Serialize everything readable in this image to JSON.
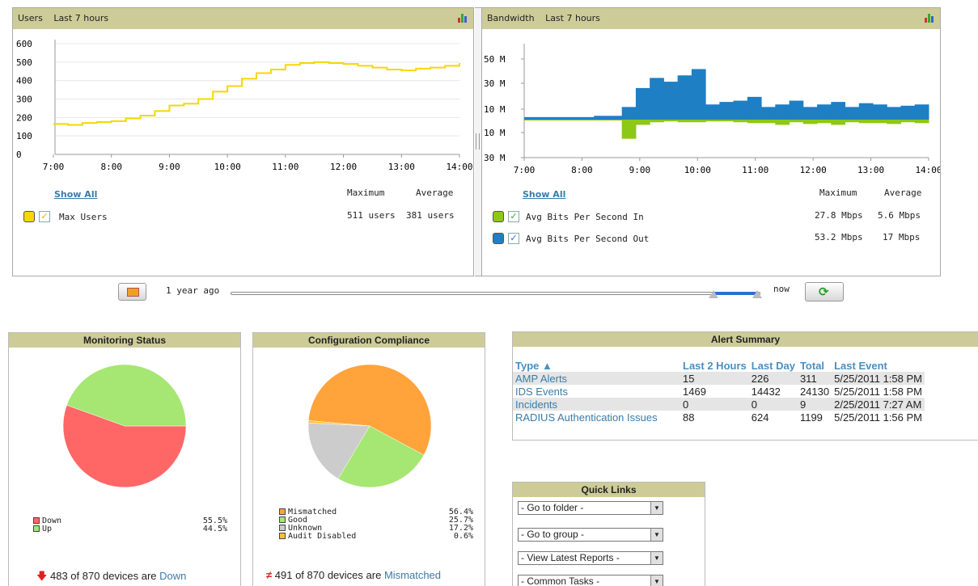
{
  "users_panel": {
    "title": "Users",
    "range": "Last 7 hours",
    "y_ticks": [
      "600",
      "500",
      "400",
      "300",
      "200",
      "100",
      "0"
    ],
    "x_ticks": [
      "7:00",
      "8:00",
      "9:00",
      "10:00",
      "11:00",
      "12:00",
      "13:00",
      "14:00"
    ],
    "show_all": "Show All",
    "col_max": "Maximum",
    "col_avg": "Average",
    "series": [
      {
        "name": "Max Users",
        "color": "#f5d800",
        "max": "511 users",
        "avg": "381 users"
      }
    ]
  },
  "bandwidth_panel": {
    "title": "Bandwidth",
    "range": "Last 7 hours",
    "y_ticks": [
      "50 M",
      "30 M",
      "10 M",
      "10 M",
      "30 M"
    ],
    "x_ticks": [
      "7:00",
      "8:00",
      "9:00",
      "10:00",
      "11:00",
      "12:00",
      "13:00",
      "14:00"
    ],
    "show_all": "Show All",
    "col_max": "Maximum",
    "col_avg": "Average",
    "series": [
      {
        "name": "Avg Bits Per Second In",
        "color": "#8cc814",
        "max": "27.8 Mbps",
        "avg": "5.6 Mbps"
      },
      {
        "name": "Avg Bits Per Second Out",
        "color": "#1e7fc4",
        "max": "53.2 Mbps",
        "avg": "17 Mbps"
      }
    ]
  },
  "timeline": {
    "start_label": "1 year ago",
    "end_label": "now",
    "selected_start_fraction": 0.93,
    "selected_end_fraction": 1.0
  },
  "monitoring": {
    "title": "Monitoring Status",
    "legend": [
      {
        "label": "Down",
        "pct": "55.5%",
        "value": 55.5,
        "color": "#ff6666"
      },
      {
        "label": "Up",
        "pct": "44.5%",
        "value": 44.5,
        "color": "#a6e672"
      }
    ],
    "status_prefix": "483 of 870 devices are",
    "status_link": "Down"
  },
  "compliance": {
    "title": "Configuration Compliance",
    "legend": [
      {
        "label": "Mismatched",
        "pct": "56.4%",
        "value": 56.4,
        "color": "#ffa33a"
      },
      {
        "label": "Good",
        "pct": "25.7%",
        "value": 25.7,
        "color": "#a6e672"
      },
      {
        "label": "Unknown",
        "pct": "17.2%",
        "value": 17.2,
        "color": "#cccccc"
      },
      {
        "label": "Audit Disabled",
        "pct": "0.6%",
        "value": 0.6,
        "color": "#ffc040"
      }
    ],
    "status_prefix": "491 of 870 devices are",
    "status_link": "Mismatched"
  },
  "alert_summary": {
    "title": "Alert Summary",
    "headers": [
      "Type ▲",
      "Last 2 Hours",
      "Last Day",
      "Total",
      "Last Event"
    ],
    "rows": [
      [
        "AMP Alerts",
        "15",
        "226",
        "311",
        "5/25/2011 1:58 PM"
      ],
      [
        "IDS Events",
        "1469",
        "14432",
        "24130",
        "5/25/2011 1:58 PM"
      ],
      [
        "Incidents",
        "0",
        "0",
        "9",
        "2/25/2011 7:27 AM"
      ],
      [
        "RADIUS Authentication Issues",
        "88",
        "624",
        "1199",
        "5/25/2011 1:56 PM"
      ]
    ]
  },
  "quick_links": {
    "title": "Quick Links",
    "selects": [
      "- Go to folder -",
      "- Go to group -",
      "- View Latest Reports -",
      "- Common Tasks -"
    ]
  },
  "chart_data": [
    {
      "type": "line",
      "title": "Users",
      "subtitle": "Last 7 hours",
      "x": [
        "7:00",
        "7:15",
        "7:30",
        "7:45",
        "8:00",
        "8:15",
        "8:30",
        "8:45",
        "9:00",
        "9:15",
        "9:30",
        "9:45",
        "10:00",
        "10:15",
        "10:30",
        "10:45",
        "11:00",
        "11:15",
        "11:30",
        "11:45",
        "12:00",
        "12:15",
        "12:30",
        "12:45",
        "13:00",
        "13:15",
        "13:30",
        "13:45",
        "14:00"
      ],
      "series": [
        {
          "name": "Max Users",
          "values": [
            165,
            160,
            170,
            175,
            180,
            195,
            210,
            235,
            265,
            275,
            300,
            340,
            370,
            410,
            440,
            460,
            485,
            495,
            500,
            495,
            490,
            480,
            470,
            460,
            455,
            465,
            470,
            480,
            495
          ]
        }
      ],
      "ylim": [
        0,
        600
      ],
      "y_ticks": [
        0,
        100,
        200,
        300,
        400,
        500,
        600
      ]
    },
    {
      "type": "area",
      "title": "Bandwidth",
      "subtitle": "Last 7 hours",
      "x": [
        "7:00",
        "7:15",
        "7:30",
        "7:45",
        "8:00",
        "8:15",
        "8:30",
        "8:45",
        "9:00",
        "9:15",
        "9:30",
        "9:45",
        "10:00",
        "10:15",
        "10:30",
        "10:45",
        "11:00",
        "11:15",
        "11:30",
        "11:45",
        "12:00",
        "12:15",
        "12:30",
        "12:45",
        "13:00",
        "13:15",
        "13:30",
        "13:45",
        "14:00"
      ],
      "series": [
        {
          "name": "Avg Bits Per Second Out",
          "values": [
            2,
            2,
            2,
            2,
            2,
            3,
            3,
            10,
            25,
            33,
            30,
            35,
            40,
            12,
            14,
            15,
            18,
            10,
            12,
            15,
            10,
            12,
            14,
            10,
            13,
            12,
            10,
            11,
            12
          ]
        },
        {
          "name": "Avg Bits Per Second In",
          "values": [
            1,
            1,
            1,
            1,
            1,
            1,
            1,
            22,
            6,
            3,
            2,
            3,
            3,
            2,
            2,
            3,
            4,
            4,
            6,
            3,
            5,
            4,
            6,
            3,
            4,
            4,
            5,
            3,
            4
          ]
        }
      ],
      "y_ticks": [
        "50 M",
        "30 M",
        "10 M",
        "10 M",
        "30 M"
      ]
    },
    {
      "type": "pie",
      "title": "Monitoring Status",
      "labels": [
        "Down",
        "Up"
      ],
      "values": [
        55.5,
        44.5
      ]
    },
    {
      "type": "pie",
      "title": "Configuration Compliance",
      "labels": [
        "Mismatched",
        "Good",
        "Unknown",
        "Audit Disabled"
      ],
      "values": [
        56.4,
        25.7,
        17.2,
        0.6
      ]
    }
  ]
}
